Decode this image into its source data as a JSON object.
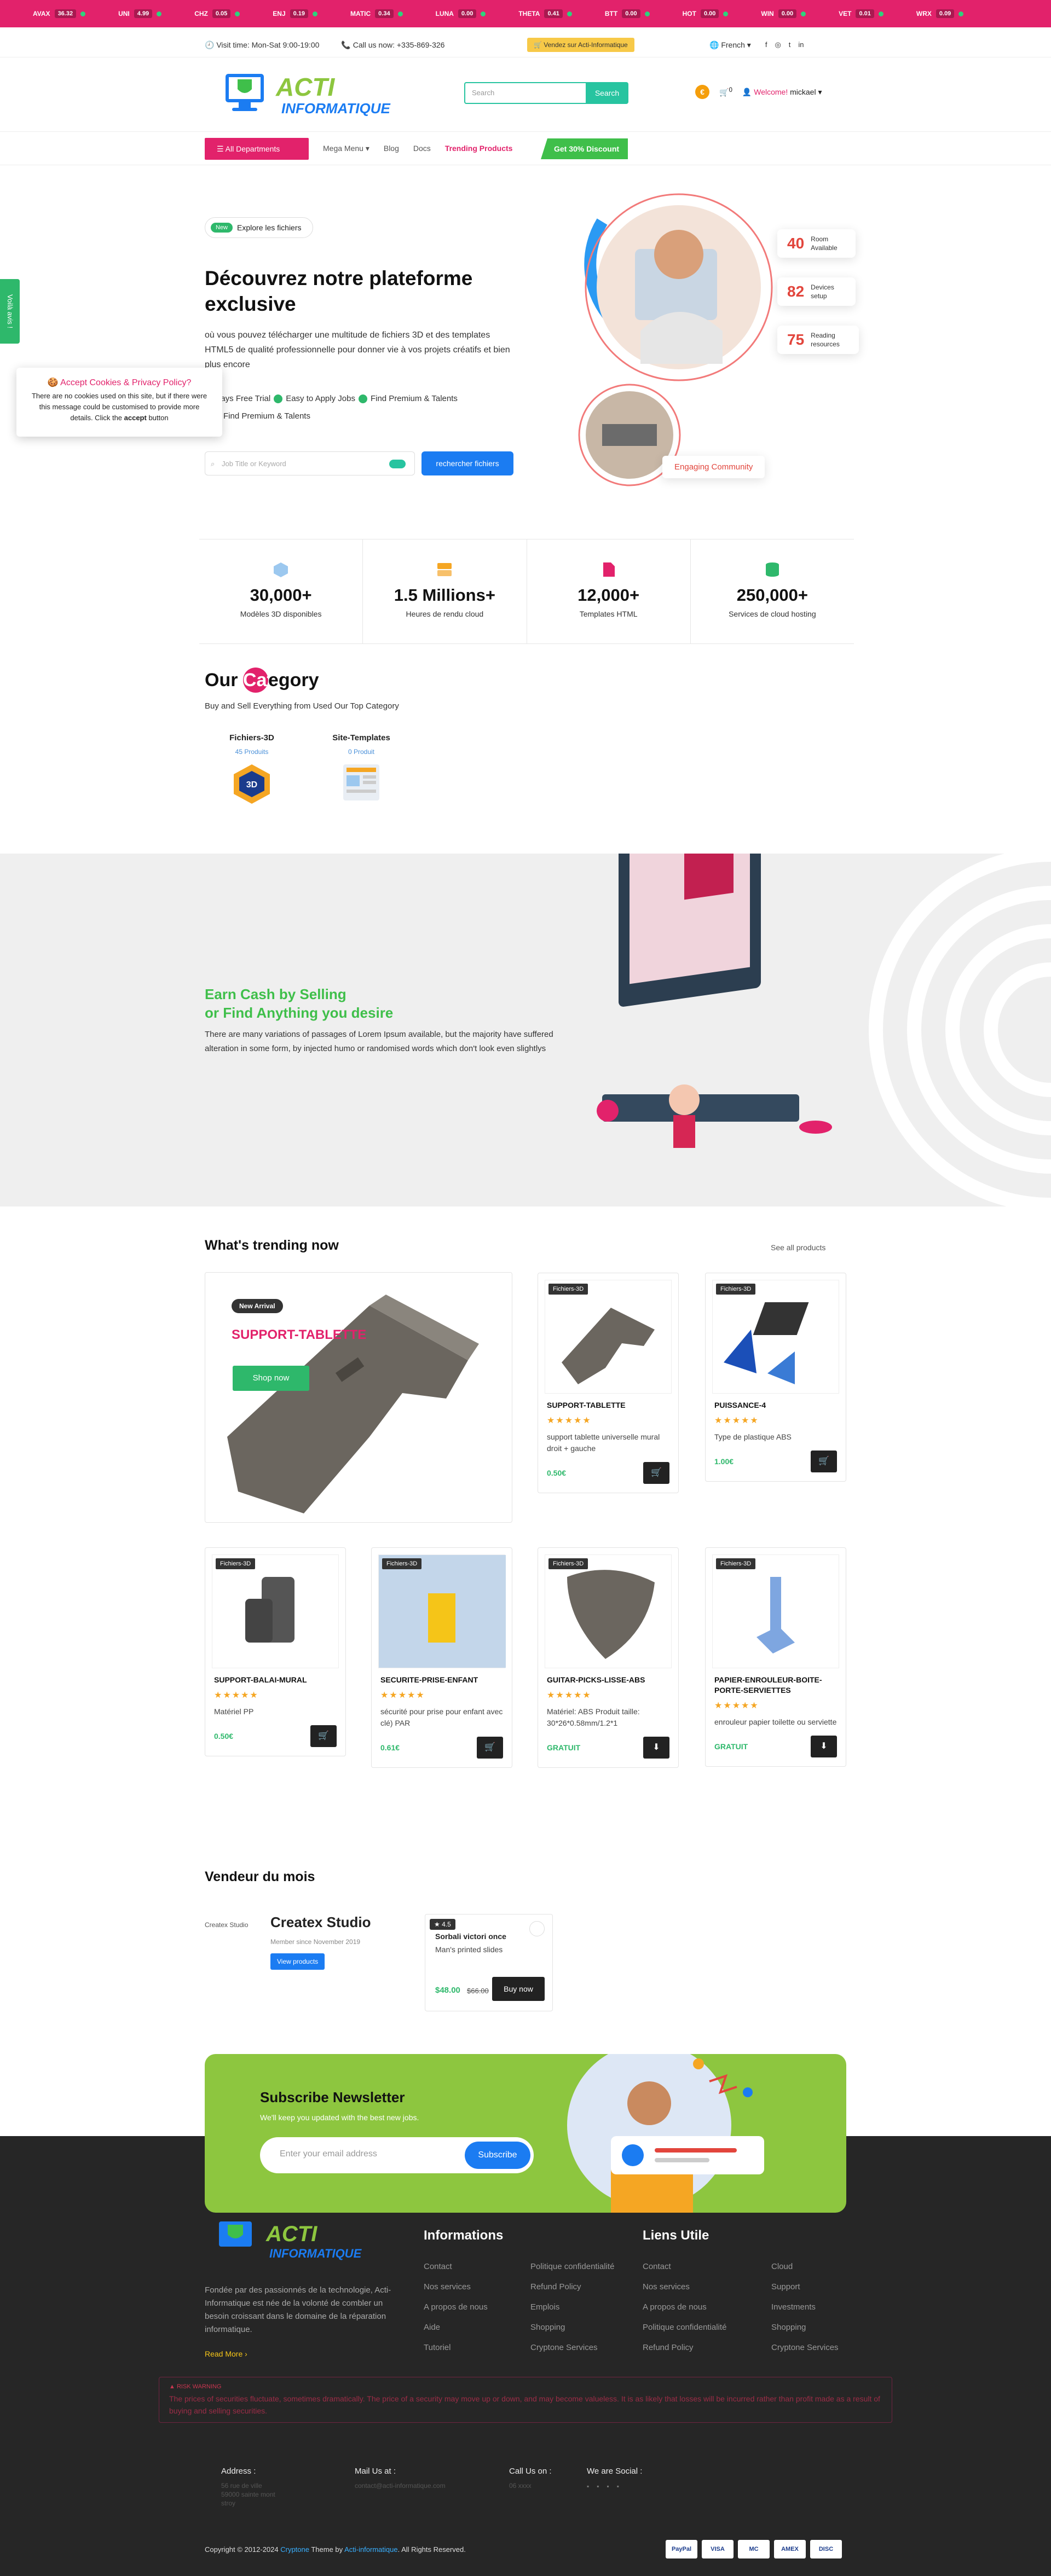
{
  "ticker": [
    {
      "sym": "AVAX",
      "price": "36.32"
    },
    {
      "sym": "UNI",
      "price": "4.99"
    },
    {
      "sym": "CHZ",
      "price": "0.05"
    },
    {
      "sym": "ENJ",
      "price": "0.19"
    },
    {
      "sym": "MATIC",
      "price": "0.34"
    },
    {
      "sym": "LUNA",
      "price": "0.00"
    },
    {
      "sym": "THETA",
      "price": "0.41"
    },
    {
      "sym": "BTT",
      "price": "0.00"
    },
    {
      "sym": "HOT",
      "price": "0.00"
    },
    {
      "sym": "WIN",
      "price": "0.00"
    },
    {
      "sym": "VET",
      "price": "0.01"
    },
    {
      "sym": "WRX",
      "price": "0.09"
    }
  ],
  "topbar": {
    "hours": "Visit time: Mon-Sat 9:00-19:00",
    "phone": "Call us now: +335-869-326",
    "vendor": "Vendez sur Acti-Informatique",
    "language": "French"
  },
  "header": {
    "logo_line1": "ACTI",
    "logo_line2": "INFORMATIQUE",
    "search_placeholder": "Search",
    "search_button": "Search",
    "cart_count": "0",
    "welcome": "Welcome!",
    "user": "mickael"
  },
  "nav": {
    "all": "All Departments",
    "items": [
      "Mega Menu",
      "Blog",
      "Docs"
    ],
    "trending": "Trending Products",
    "discount": "Get 30% Discount"
  },
  "side_tab": "Voilà avis !",
  "hero": {
    "badge": "New",
    "pill": "Explore les fichiers",
    "title": "Découvrez notre plateforme exclusive",
    "text": "où vous pouvez télécharger une multitude de fichiers 3D et des templates HTML5 de qualité professionnelle pour donner vie à vos projets créatifs et bien plus encore",
    "features": [
      "7 Days Free Trial",
      "Easy to Apply Jobs",
      "Find Premium & Talents",
      "Find Premium & Talents"
    ],
    "search_placeholder": "Job Title or Keyword",
    "search_button": "rechercher fichiers",
    "cards": [
      {
        "num": "40",
        "label": "Room Available"
      },
      {
        "num": "82",
        "label": "Devices setup"
      },
      {
        "num": "75",
        "label": "Reading resources"
      }
    ],
    "community": "Engaging Community"
  },
  "cookie": {
    "title": "Accept Cookies & Privacy Policy?",
    "text": "There are no cookies used on this site, but if there were this message could be customised to provide more details. Click the ",
    "bold": "accept",
    "tail": " button"
  },
  "stats": [
    {
      "value": "30,000+",
      "label": "Modèles 3D disponibles",
      "color": "#4a90d9"
    },
    {
      "value": "1.5 Millions+",
      "label": "Heures de rendu cloud",
      "color": "#f5a623"
    },
    {
      "value": "12,000+",
      "label": "Templates HTML",
      "color": "#e2226b"
    },
    {
      "value": "250,000+",
      "label": "Services de cloud hosting",
      "color": "#2eb86b"
    }
  ],
  "category": {
    "title_a": "Our ",
    "title_hl": "Cat",
    "title_b": "egory",
    "subtitle": "Buy and Sell Everything from Used Our Top Category",
    "items": [
      {
        "name": "Fichiers-3D",
        "count": "45 Produits"
      },
      {
        "name": "Site-Templates",
        "count": "0 Produit"
      }
    ]
  },
  "band": {
    "title1": "Earn Cash by Selling",
    "title2": "or Find Anything you desire",
    "text": "There are many variations of passages of Lorem Ipsum available, but the majority have suffered alteration in some form, by injected humo or randomised words which don't look even slightlys"
  },
  "trending": {
    "title": "What's trending now",
    "see_all": "See all products",
    "big": {
      "badge": "New Arrival",
      "title": "SUPPORT-TABLETTE",
      "button": "Shop now"
    },
    "products": [
      {
        "badge": "Fichiers-3D",
        "name": "SUPPORT-TABLETTE",
        "desc": "support tablette universelle mural droit + gauche",
        "price": "0.50€",
        "icon": "cart"
      },
      {
        "badge": "Fichiers-3D",
        "name": "PUISSANCE-4",
        "desc": "Type de plastique ABS",
        "price": "1.00€",
        "icon": "cart"
      },
      {
        "badge": "Fichiers-3D",
        "name": "SUPPORT-BALAI-MURAL",
        "desc": "Matériel PP",
        "price": "0.50€",
        "icon": "cart"
      },
      {
        "badge": "Fichiers-3D",
        "name": "SECURITE-PRISE-ENFANT",
        "desc": "sécurité pour prise pour enfant avec clé) PAR",
        "price": "0.61€",
        "icon": "cart"
      },
      {
        "badge": "Fichiers-3D",
        "name": "GUITAR-PICKS-LISSE-ABS",
        "desc": "Matériel: ABS Produit taille: 30*26*0.58mm/1.2*1",
        "price": "GRATUIT",
        "icon": "download"
      },
      {
        "badge": "Fichiers-3D",
        "name": "PAPIER-ENROULEUR-BOITE-PORTE-SERVIETTES",
        "desc": "enrouleur papier toilette ou serviette",
        "price": "GRATUIT",
        "icon": "download"
      }
    ]
  },
  "vendor": {
    "title": "Vendeur du mois",
    "avatar_alt": "Createx Studio",
    "name": "Createx Studio",
    "since": "Member since November 2019",
    "button": "View products",
    "product": {
      "rating": "4.5",
      "name": "Sorbali victori once",
      "sub": "Man's printed slides",
      "price": "$48.00",
      "old": "$66.00",
      "button": "Buy now"
    }
  },
  "newsletter": {
    "title": "Subscribe Newsletter",
    "subtitle": "We'll keep you updated with the best new jobs.",
    "placeholder": "Enter your email address",
    "button": "Subscribe"
  },
  "footer": {
    "about": "Fondée par des passionnés de la technologie, Acti-Informatique est née de la volonté de combler un besoin croissant dans le domaine de la réparation informatique.",
    "read_more": "Read More",
    "informations": {
      "title": "Informations",
      "links": [
        "Contact",
        "Politique confidentialité",
        "Nos services",
        "Refund Policy",
        "A propos de nous",
        "Emplois",
        "Aide",
        "Shopping",
        "Tutoriel",
        "Cryptone Services"
      ]
    },
    "liens": {
      "title": "Liens Utile",
      "links": [
        "Contact",
        "Cloud",
        "Nos services",
        "Support",
        "A propos de nous",
        "Investments",
        "Politique confidentialité",
        "Shopping",
        "Refund Policy",
        "Cryptone Services"
      ]
    },
    "risk_head": "▲ RISK WARNING",
    "risk": "The prices of securities fluctuate, sometimes dramatically. The price of a security may move up or down, and may become valueless. It is as likely that losses will be incurred rather than profit made as a result of buying and selling securities.",
    "address": {
      "label": "Address :",
      "value": "56 rue de ville 59000 sainte mont stroy"
    },
    "mail": {
      "label": "Mail Us at :",
      "value": "contact@acti-informatique.com"
    },
    "call": {
      "label": "Call Us on :",
      "value": "06 xxxx"
    },
    "social": {
      "label": "We are Social :"
    },
    "copy_a": "Copyright © 2012-2024 ",
    "brand": "Cryptone",
    "copy_b": " Theme by ",
    "brand2": "Acti-informatique",
    "copy_c": ". All Rights Reserved.",
    "payments": [
      "PayPal",
      "VISA",
      "MC",
      "AMEX",
      "DISC"
    ]
  }
}
